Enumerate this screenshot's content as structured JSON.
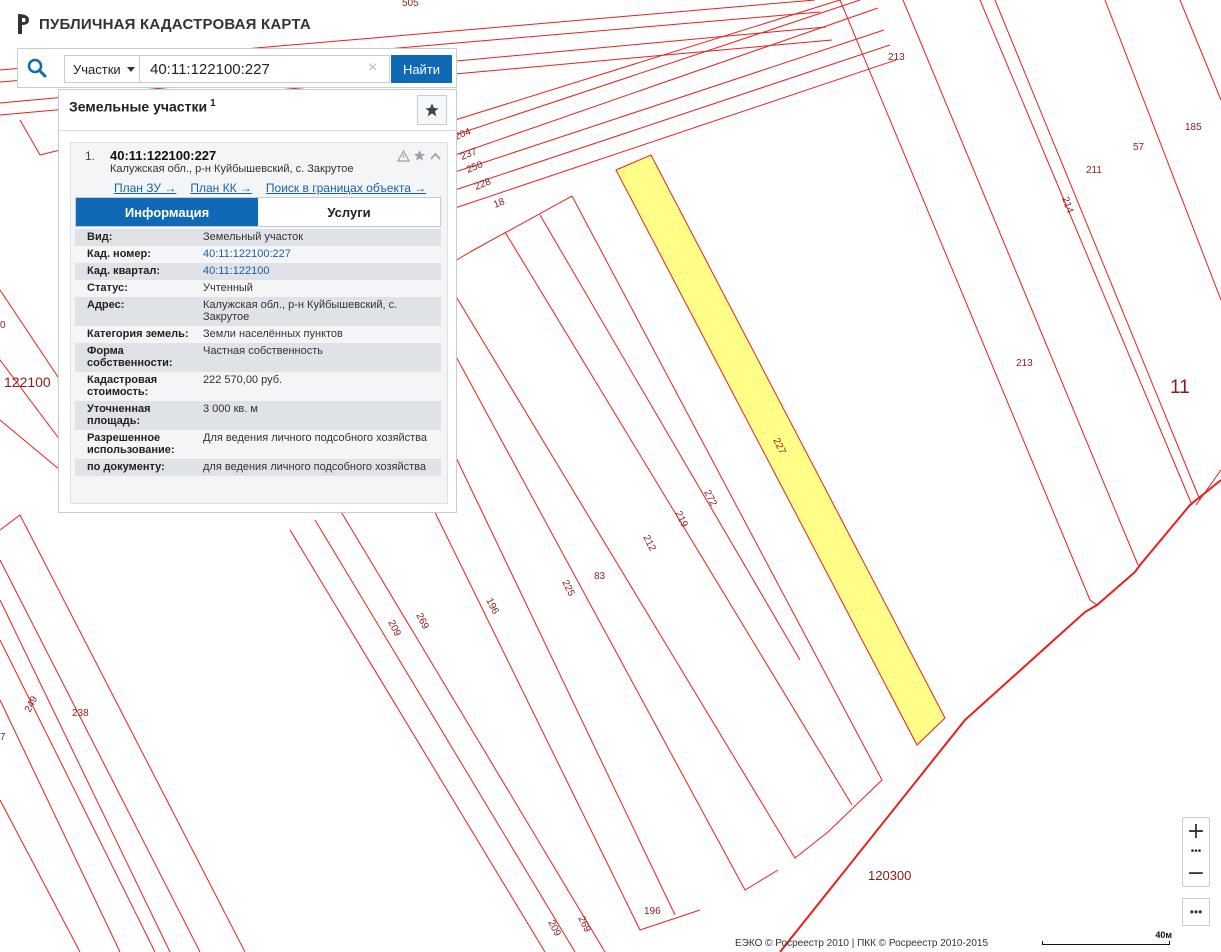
{
  "app": {
    "title": "ПУБЛИЧНАЯ КАДАСТРОВАЯ КАРТА"
  },
  "search": {
    "type_label": "Участки",
    "value": "40:11:122100:227",
    "find_label": "Найти"
  },
  "results": {
    "header": "Земельные участки",
    "count": "1",
    "item": {
      "index": "1.",
      "number": "40:11:122100:227",
      "address": "Калужская обл., р-н Куйбышевский, с. Закрутое",
      "links": {
        "plan_zu": "План ЗУ →",
        "plan_kk": "План КК →",
        "search_in_bounds": "Поиск в границах объекта →"
      },
      "tabs": {
        "info": "Информация",
        "services": "Услуги"
      },
      "fields": [
        {
          "key": "Вид:",
          "value": "Земельный участок"
        },
        {
          "key": "Кад. номер:",
          "value": "40:11:122100:227",
          "link": true
        },
        {
          "key": "Кад. квартал:",
          "value": "40:11:122100",
          "link": true
        },
        {
          "key": "Статус:",
          "value": "Учтенный"
        },
        {
          "key": "Адрес:",
          "value": "Калужская обл., р-н Куйбышевский, с. Закрутое"
        },
        {
          "key": "Категория земель:",
          "value": "Земли населённых пунктов"
        },
        {
          "key": "Форма собственности:",
          "value": "Частная собственность"
        },
        {
          "key": "Кадастровая стоимость:",
          "value": "222 570,00 руб."
        },
        {
          "key": "Уточненная площадь:",
          "value": "3 000 кв. м"
        },
        {
          "key": "Разрешенное использование:",
          "value": "Для ведения личного подсобного хозяйства"
        },
        {
          "key": "по документу:",
          "value": "для ведения личного подсобного хозяйства"
        }
      ]
    }
  },
  "map": {
    "parcel_color": "#e8201c",
    "selected_fill": "#ffff88",
    "label_color": "#8b1a1a",
    "labels": [
      "505",
      "213",
      "185",
      "57",
      "211",
      "214",
      "204",
      "237",
      "250",
      "228",
      "18",
      "227",
      "272",
      "219",
      "212",
      "83",
      "225",
      "196",
      "269",
      "209",
      "238",
      "249",
      "7",
      "0",
      "213",
      "11",
      "122100",
      "120300",
      "196",
      "209",
      "269"
    ]
  },
  "controls": {
    "zoom_in": "+",
    "zoom_out": "−",
    "zoom_dots": "•••",
    "more": "•••"
  },
  "footer": {
    "attribution": "ЕЭКО © Росреестр 2010 | ПКК © Росреестр 2010-2015",
    "scale": "40м"
  }
}
